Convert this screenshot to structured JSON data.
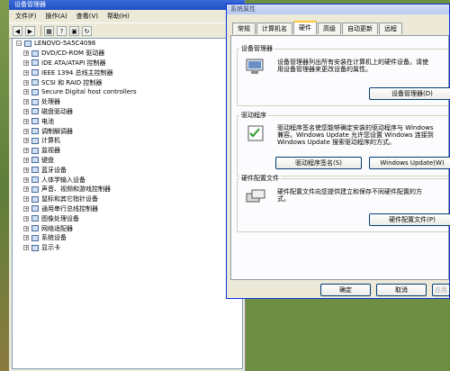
{
  "devmgr": {
    "title": "设备管理器",
    "menu": [
      "文件(F)",
      "操作(A)",
      "查看(V)",
      "帮助(H)"
    ],
    "toolbar": [
      "back-icon",
      "forward-icon",
      "properties-icon",
      "help-icon",
      "view-icon",
      "refresh-icon"
    ],
    "root": "LENOVO-5A5C4098",
    "devices": [
      {
        "label": "DVD/CD-ROM 驱动器",
        "icon": "dvd-drive-icon"
      },
      {
        "label": "IDE ATA/ATAPI 控制器",
        "icon": "ide-controller-icon"
      },
      {
        "label": "IEEE 1394 总线主控制器",
        "icon": "ieee1394-icon"
      },
      {
        "label": "SCSI 和 RAID 控制器",
        "icon": "scsi-icon"
      },
      {
        "label": "Secure Digital host controllers",
        "icon": "sd-host-icon"
      },
      {
        "label": "处理器",
        "icon": "processor-icon"
      },
      {
        "label": "磁盘驱动器",
        "icon": "disk-drive-icon"
      },
      {
        "label": "电池",
        "icon": "battery-icon"
      },
      {
        "label": "调制解调器",
        "icon": "modem-icon"
      },
      {
        "label": "计算机",
        "icon": "computer-icon"
      },
      {
        "label": "监视器",
        "icon": "monitor-icon"
      },
      {
        "label": "键盘",
        "icon": "keyboard-icon"
      },
      {
        "label": "蓝牙设备",
        "icon": "bluetooth-icon"
      },
      {
        "label": "人体学输入设备",
        "icon": "hid-icon"
      },
      {
        "label": "声音、视频和游戏控制器",
        "icon": "sound-icon"
      },
      {
        "label": "鼠标和其它指针设备",
        "icon": "mouse-icon"
      },
      {
        "label": "通用串行总线控制器",
        "icon": "usb-icon"
      },
      {
        "label": "图像处理设备",
        "icon": "imaging-icon"
      },
      {
        "label": "网络适配器",
        "icon": "network-adapter-icon"
      },
      {
        "label": "系统设备",
        "icon": "system-device-icon"
      },
      {
        "label": "显示卡",
        "icon": "display-adapter-icon"
      }
    ]
  },
  "sysprops": {
    "title": "系统属性",
    "tabs": [
      "常规",
      "计算机名",
      "硬件",
      "高级",
      "自动更新",
      "远程"
    ],
    "active_tab": "硬件",
    "device_manager": {
      "title": "设备管理器",
      "lines": [
        "设备管理器列出所有安装在计算机上的硬件设备。请使",
        "用设备管理器来更改设备的属性。"
      ],
      "button": "设备管理器(D)"
    },
    "drivers": {
      "title": "驱动程序",
      "lines": [
        "驱动程序签名使您能够确定安装的驱动程序与 Windows",
        "兼容。Windows Update 允许您设置 Windows 连接到",
        "Windows Update 搜索驱动程序的方式。"
      ],
      "signing_button": "驱动程序签名(S)",
      "update_button": "Windows Update(W)"
    },
    "profiles": {
      "title": "硬件配置文件",
      "lines": [
        "硬件配置文件向您提供建立和保存不同硬件配置的方",
        "式。"
      ],
      "button": "硬件配置文件(P)"
    },
    "ok": "确定",
    "cancel": "取消",
    "apply": "应用"
  }
}
